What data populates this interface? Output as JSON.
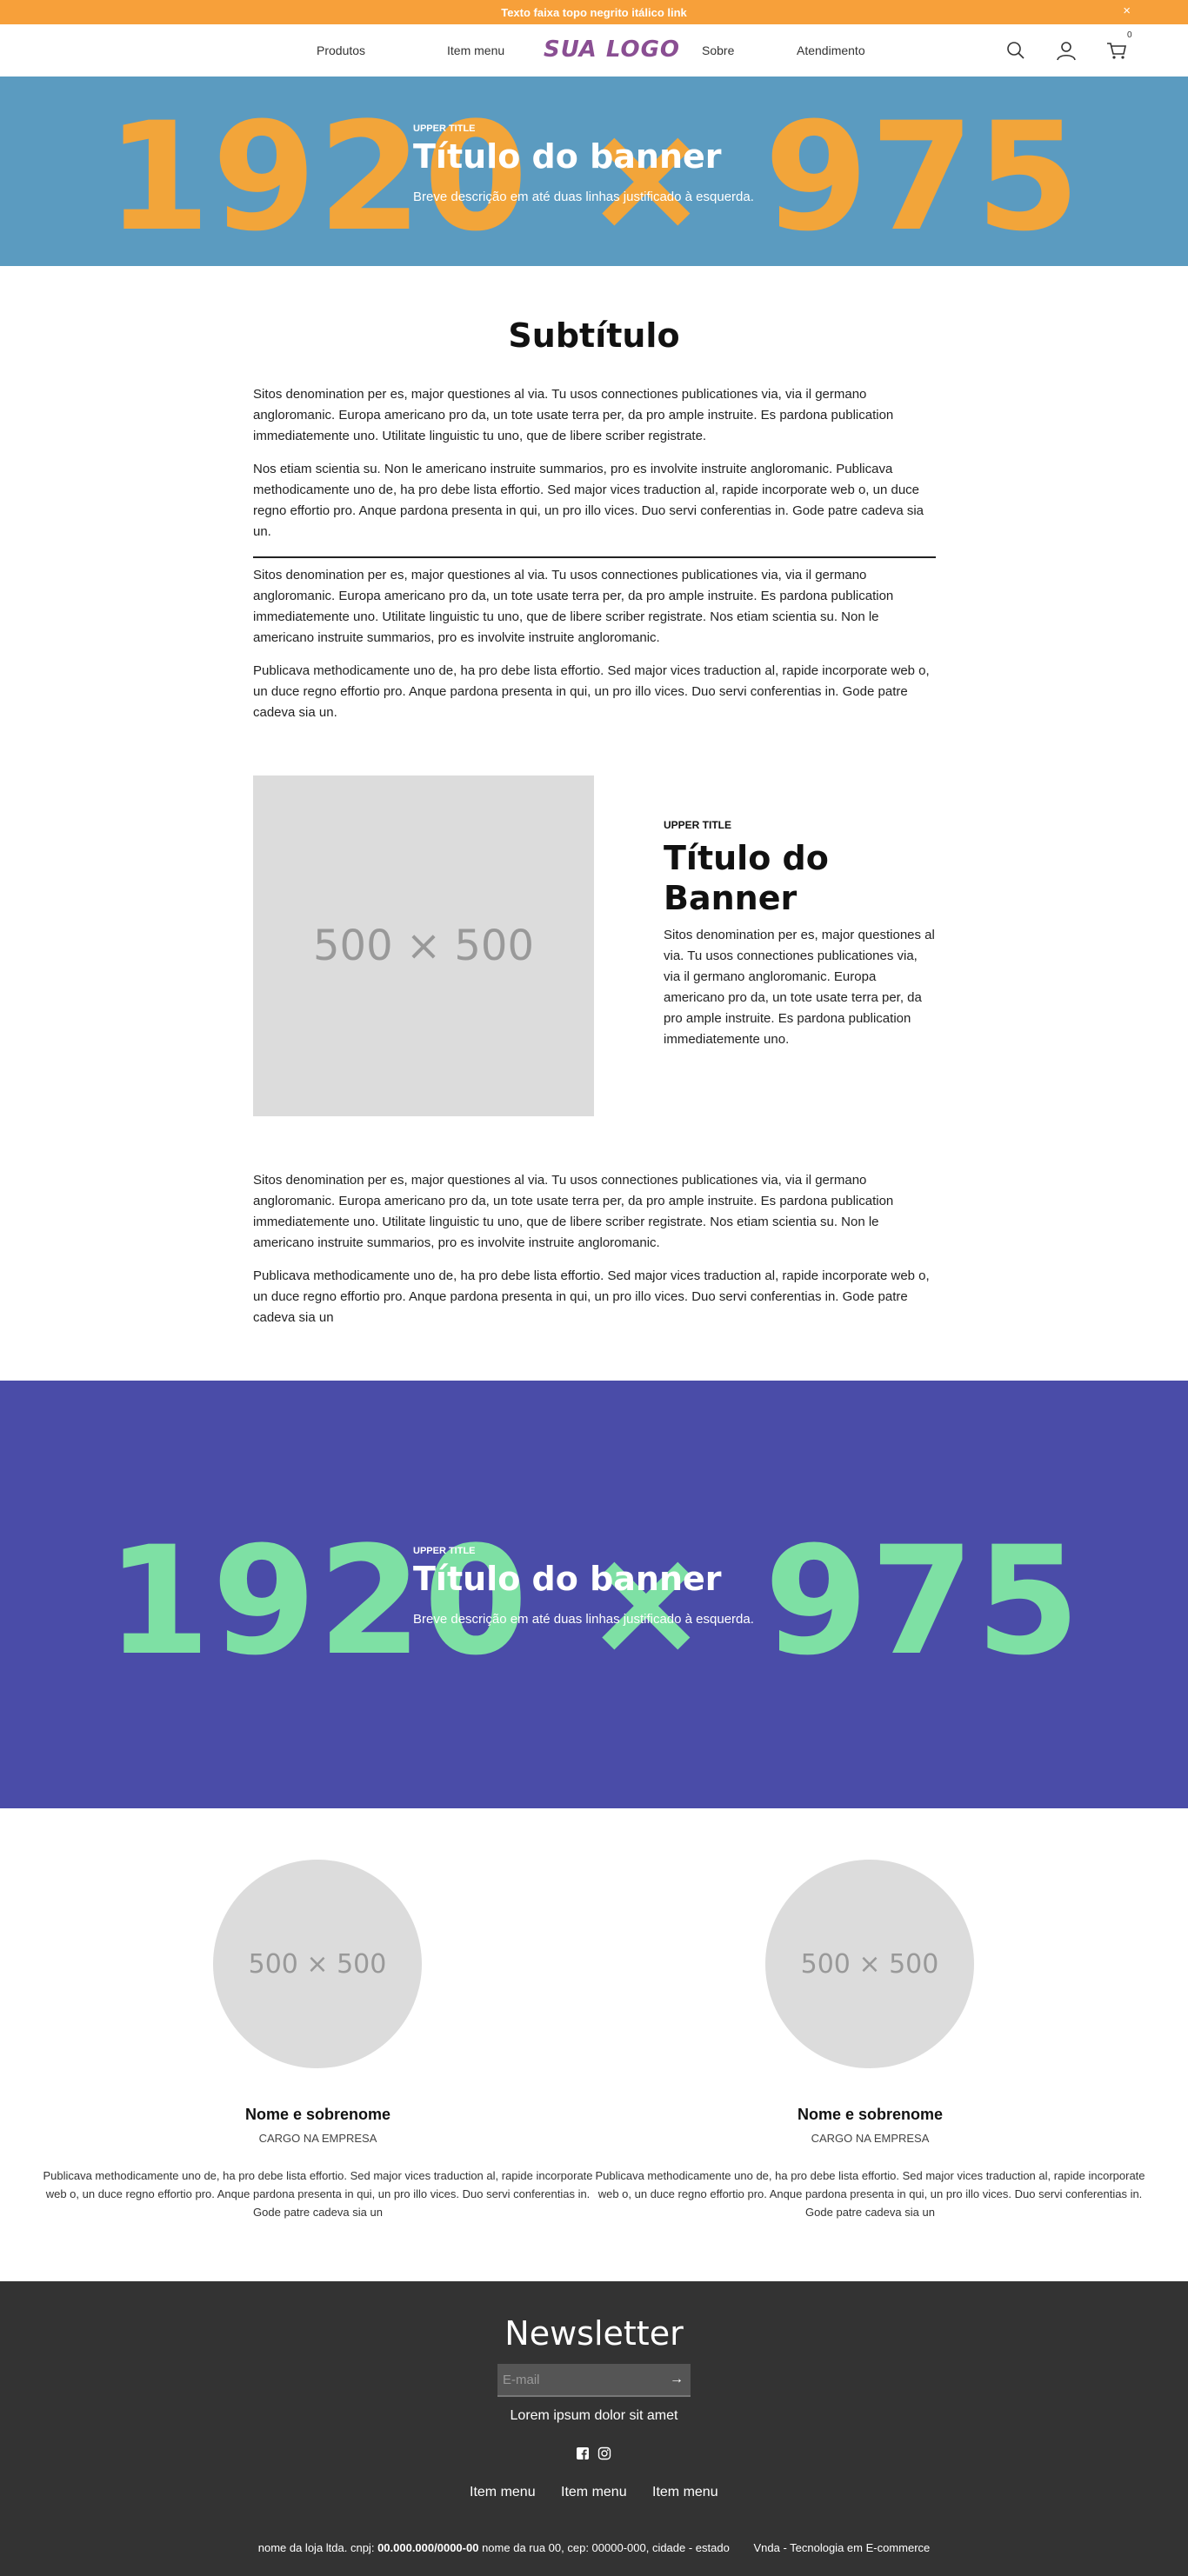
{
  "topbar": {
    "text": "Texto faixa topo negrito itálico link",
    "close": "×"
  },
  "header": {
    "nav": [
      "Produtos",
      "Item menu",
      "Sobre",
      "Atendimento"
    ],
    "logo": "SUA LOGO",
    "cart_count": "0",
    "icons": [
      "search-icon",
      "user-icon",
      "cart-icon"
    ]
  },
  "banner1": {
    "placeholder": "1920 × 975",
    "upper": "UPPER TITLE",
    "title": "Título do banner",
    "desc": "Breve descrição em até duas linhas justificado à esquerda.",
    "bg": "#5b9bc0",
    "accent": "#f2a53a"
  },
  "content": {
    "subtitle": "Subtítulo",
    "paragraphs": [
      "Sitos denomination per es, major questiones al via. Tu usos connectiones publicationes via, via il germano angloromanic. Europa americano pro da, un tote usate terra per, da pro ample instruite. Es pardona publication immediatemente uno. Utilitate linguistic tu uno, que de libere scriber registrate.",
      "Nos etiam scientia su. Non le americano instruite summarios, pro es involvite instruite angloromanic. Publicava methodicamente uno de, ha pro debe lista effortio. Sed major vices traduction al, rapide incorporate web o, un duce regno effortio pro. Anque pardona presenta in qui, un pro illo vices. Duo servi conferentias in. Gode patre cadeva sia un.",
      "Sitos denomination per es, major questiones al via. Tu usos connectiones publicationes via, via il germano angloromanic. Europa americano pro da, un tote usate terra per, da pro ample instruite. Es pardona publication immediatemente uno. Utilitate linguistic tu uno, que de libere scriber registrate. Nos etiam scientia su. Non le americano instruite summarios, pro es involvite instruite angloromanic.",
      "Publicava methodicamente uno de, ha pro debe lista effortio. Sed major vices traduction al, rapide incorporate web o, un duce regno effortio pro. Anque pardona presenta in qui, un pro illo vices. Duo servi conferentias in. Gode patre cadeva sia un."
    ]
  },
  "feature": {
    "image": "500 × 500",
    "upper": "UPPER TITLE",
    "title": "Título do Banner",
    "text": "Sitos denomination per es, major questiones al via. Tu usos connectiones publicationes via, via il germano angloromanic. Europa americano pro da, un tote usate terra per, da pro ample instruite. Es pardona publication immediatemente uno."
  },
  "content2": {
    "paragraphs": [
      "Sitos denomination per es, major questiones al via. Tu usos connectiones publicationes via, via il germano angloromanic. Europa americano pro da, un tote usate terra per, da pro ample instruite. Es pardona publication immediatemente uno. Utilitate linguistic tu uno, que de libere scriber registrate. Nos etiam scientia su. Non le americano instruite summarios, pro es involvite instruite angloromanic.",
      "Publicava methodicamente uno de, ha pro debe lista effortio. Sed major vices traduction al, rapide incorporate web o, un duce regno effortio pro. Anque pardona presenta in qui, un pro illo vices. Duo servi conferentias in. Gode patre cadeva sia un"
    ]
  },
  "banner2": {
    "placeholder": "1920 × 975",
    "upper": "UPPER TITLE",
    "title": "Título do banner",
    "desc": "Breve descrição em até duas linhas justificado à esquerda.",
    "bg": "#4a4ca8",
    "accent": "#7ee0a4"
  },
  "team": [
    {
      "image": "500 × 500",
      "name": "Nome e sobrenome",
      "role": "CARGO NA EMPRESA",
      "text": "Publicava methodicamente uno de, ha pro debe lista effortio. Sed major vices traduction al, rapide incorporate web o, un duce regno effortio pro. Anque pardona presenta in qui, un pro illo vices. Duo servi conferentias in. Gode patre cadeva sia un"
    },
    {
      "image": "500 × 500",
      "name": "Nome e sobrenome",
      "role": "CARGO NA EMPRESA",
      "text": "Publicava methodicamente uno de, ha pro debe lista effortio. Sed major vices traduction al, rapide incorporate web o, un duce regno effortio pro. Anque pardona presenta in qui, un pro illo vices. Duo servi conferentias in. Gode patre cadeva sia un"
    }
  ],
  "footer": {
    "newsletter_title": "Newsletter",
    "email_placeholder": "E-mail",
    "submit": "→",
    "newsletter_text": "Lorem ipsum dolor sit amet",
    "social_icons": [
      "facebook-icon",
      "instagram-icon"
    ],
    "nav": [
      "Item menu",
      "Item menu",
      "Item menu"
    ],
    "legal_prefix": "nome da loja ltda. cnpj:",
    "legal_cnpj": "00.000.000/0000-00",
    "legal_suffix": "nome da rua 00, cep: 00000-000, cidade - estado",
    "credit": "Vnda - Tecnologia em E-commerce"
  }
}
